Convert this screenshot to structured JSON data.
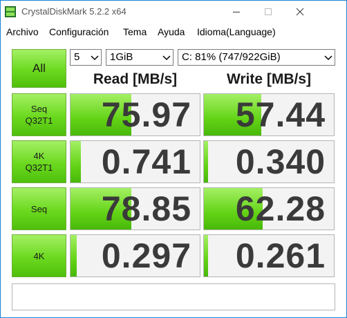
{
  "window": {
    "title": "CrystalDiskMark 5.2.2 x64",
    "accent": "#1883d7"
  },
  "menu": [
    "Archivo",
    "Configuración",
    "Tema",
    "Ayuda",
    "Idioma(Language)"
  ],
  "controls": {
    "all_label": "All",
    "test_count": "5",
    "test_size": "1GiB",
    "drive": "C: 81% (747/922GiB)"
  },
  "headers": {
    "read": "Read [MB/s]",
    "write": "Write [MB/s]"
  },
  "rows": [
    {
      "label1": "Seq",
      "label2": "Q32T1",
      "read": "75.97",
      "write": "57.44",
      "read_fill": 0.47,
      "write_fill": 0.44
    },
    {
      "label1": "4K",
      "label2": "Q32T1",
      "read": "0.741",
      "write": "0.340",
      "read_fill": 0.08,
      "write_fill": 0.03
    },
    {
      "label1": "Seq",
      "label2": "",
      "read": "78.85",
      "write": "62.28",
      "read_fill": 0.47,
      "write_fill": 0.45
    },
    {
      "label1": "4K",
      "label2": "",
      "read": "0.297",
      "write": "0.261",
      "read_fill": 0.05,
      "write_fill": 0.03
    }
  ],
  "status_text": "",
  "colors": {
    "bar_green": "#63d316",
    "value_text": "#3a3a3a"
  }
}
